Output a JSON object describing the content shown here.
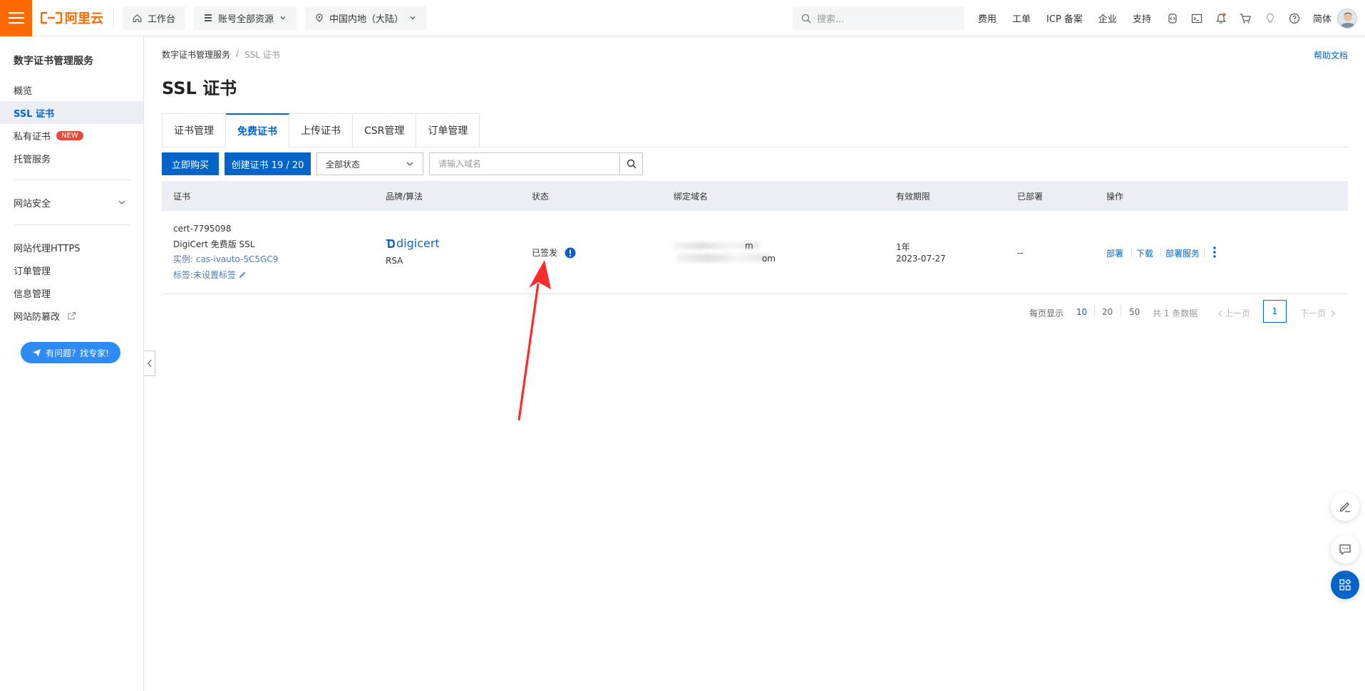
{
  "topbar": {
    "brand": "阿里云",
    "workbench": "工作台",
    "resources": "账号全部资源",
    "region": "中国内地（大陆）",
    "search_placeholder": "搜索...",
    "links": [
      "费用",
      "工单",
      "ICP 备案",
      "企业",
      "支持"
    ],
    "language": "简体"
  },
  "sidebar": {
    "title": "数字证书管理服务",
    "items": [
      {
        "label": "概览"
      },
      {
        "label": "SSL 证书"
      },
      {
        "label": "私有证书",
        "badge": "NEW"
      },
      {
        "label": "托管服务"
      }
    ],
    "group": "网站安全",
    "items2": [
      {
        "label": "网站代理HTTPS"
      },
      {
        "label": "订单管理"
      },
      {
        "label": "信息管理"
      },
      {
        "label": "网站防篡改"
      }
    ],
    "expert_button": "有问题？找专家!"
  },
  "breadcrumb": {
    "root": "数字证书管理服务",
    "sep": "/",
    "current": "SSL 证书"
  },
  "help_link": "帮助文档",
  "page_title": "SSL 证书",
  "tabs": [
    {
      "label": "证书管理"
    },
    {
      "label": "免费证书",
      "active": true
    },
    {
      "label": "上传证书"
    },
    {
      "label": "CSR管理"
    },
    {
      "label": "订单管理"
    }
  ],
  "toolbar": {
    "buy": "立即购买",
    "create": "创建证书 19 / 20",
    "status_select": "全部状态",
    "domain_placeholder": "请输入域名"
  },
  "table": {
    "headers": [
      "证书",
      "品牌/算法",
      "状态",
      "绑定域名",
      "有效期限",
      "已部署",
      "操作"
    ],
    "rows": [
      {
        "cert_id": "cert-7795098",
        "cert_name": "DigiCert 免费版 SSL",
        "instance": "实例: cas-ivauto-5C5GC9",
        "tag": "标签:未设置标签",
        "brand": "digicert",
        "algorithm": "RSA",
        "status": "已签发",
        "domain_line1": "m",
        "domain_line2": "om",
        "validity": "1年",
        "expire": "2023-07-27",
        "deployed": "--",
        "actions": [
          "部署",
          "下载",
          "部署服务"
        ]
      }
    ]
  },
  "pagination": {
    "per_page_label": "每页显示",
    "sizes": [
      "10",
      "20",
      "50"
    ],
    "total": "共 1 条数据",
    "prev": "上一页",
    "current": "1",
    "next": "下一页"
  },
  "colors": {
    "brand_orange": "#ff6a00",
    "primary_blue": "#0064c8",
    "arrow_red": "#ff2a2a"
  }
}
